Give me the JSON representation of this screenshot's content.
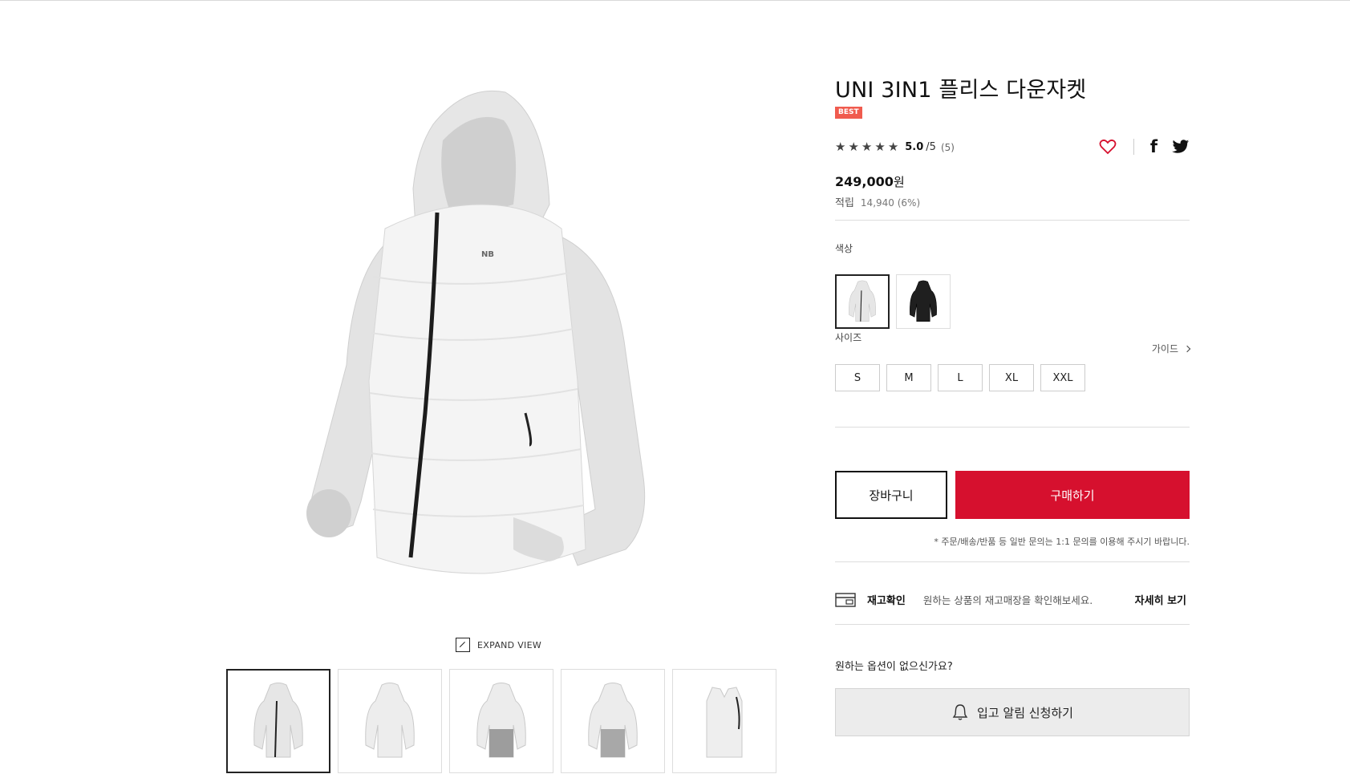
{
  "product": {
    "title": "UNI 3IN1 플리스 다운자켓",
    "badge": "BEST",
    "rating_score": "5.0",
    "rating_max": "/5",
    "rating_count": "(5)",
    "rating_stars": 5,
    "price_value": "249,000",
    "price_unit": "원",
    "points_label": "적립",
    "points_value": "14,940 (6%)"
  },
  "options": {
    "color_label": "색상",
    "size_label": "사이즈",
    "guide_label": "가이드",
    "sizes": [
      "S",
      "M",
      "L",
      "XL",
      "XXL"
    ]
  },
  "buttons": {
    "cart": "장바구니",
    "buy": "구매하기",
    "notice": "* 주문/배송/반품 등 일반 문의는 1:1 문의를 이용해 주시기 바랍니다."
  },
  "stock": {
    "title": "재고확인",
    "desc": "원하는 상품의 재고매장을 확인해보세요.",
    "link": "자세히 보기"
  },
  "restock": {
    "question": "원하는 옵션이 없으신가요?",
    "button": "입고 알림 신청하기"
  },
  "gallery": {
    "expand_label": "EXPAND VIEW"
  },
  "colors": {
    "accent_red": "#d6102e",
    "badge": "#f05b4e"
  }
}
